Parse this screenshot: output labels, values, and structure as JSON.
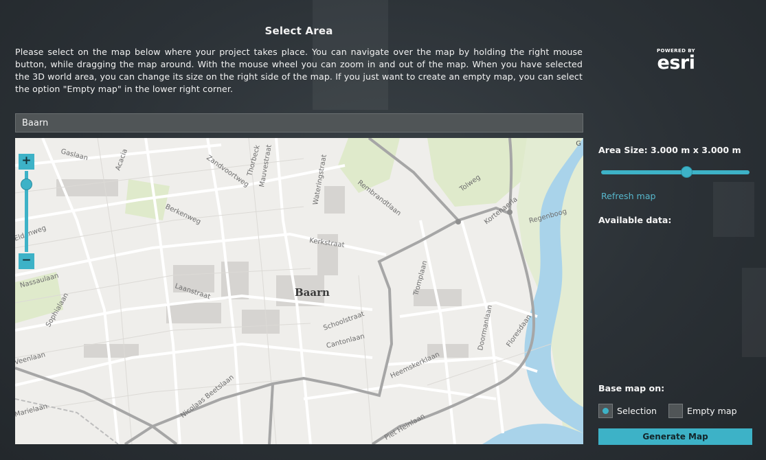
{
  "dialog": {
    "title": "Select Area",
    "intro": "Please select on the map below where your project takes place. You can navigate over the map by holding the right mouse button, while dragging the map around. With the mouse wheel you can zoom in and out of the map. When you have selected the 3D world area, you can change its size on the right side of the map. If you just want to create an empty map, you can select the option \"Empty map\" in the lower right corner."
  },
  "logo": {
    "powered_by": "POWERED BY",
    "name": "esri"
  },
  "search": {
    "value": "Baarn"
  },
  "map": {
    "zoom_in": "+",
    "zoom_out": "−",
    "corner_mark": "G",
    "city_label": "Baarn",
    "street_labels": [
      "Gaslaan",
      "Acacia",
      "Thorbeck",
      "Mauvestraat",
      "Zandvoortweg",
      "Wateringstraat",
      "Rembrandtlaan",
      "Tolweg",
      "Kortenaerla",
      "Regenboog",
      "Berkenweg",
      "Kerkstraat",
      "Tromplaan",
      "Nassaulaan",
      "Laanstraat",
      "Sophialaan",
      "Schoolstraat",
      "Cantonlaan",
      "Veenlaan",
      "Heemskerklaan",
      "Doormanlaan",
      "Floresdaan",
      "Nicolaas Beetslaan",
      "Marielaan",
      "Piet Heinlaan",
      "Eldenweg"
    ]
  },
  "area_size": {
    "label": "Area Size: 3.000 m x 3.000 m",
    "slider_fraction": 0.56
  },
  "refresh_label": "Refresh map",
  "available_data_label": "Available data:",
  "base_map": {
    "label": "Base map on:",
    "options": [
      {
        "label": "Selection",
        "selected": true
      },
      {
        "label": "Empty map",
        "selected": false
      }
    ]
  },
  "generate_label": "Generate Map",
  "colors": {
    "accent": "#3db2c7",
    "link": "#57b7cc",
    "water": "#a9d3ea",
    "park": "#dfeacb"
  }
}
